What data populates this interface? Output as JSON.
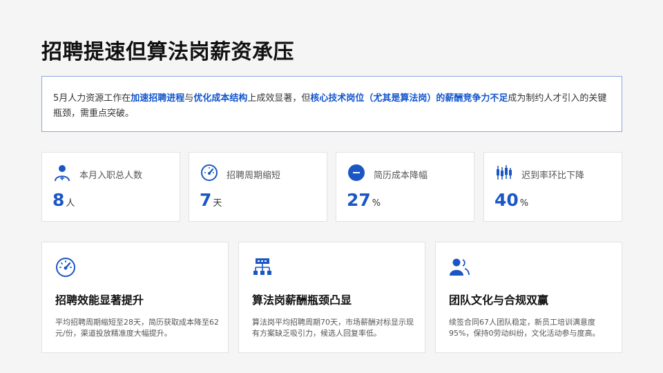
{
  "title": "招聘提速但算法岗薪资承压",
  "summary": {
    "t1": "5月人力资源工作在",
    "h1": "加速招聘进程",
    "t2": "与",
    "h2": "优化成本结构",
    "t3": "上成效显著，但",
    "h3": "核心技术岗位（尤其是算法岗）的薪酬竞争力不足",
    "t4": "成为制约人才引入的关键瓶颈，需重点突破。"
  },
  "stats": [
    {
      "label": "本月入职总人数",
      "value": "8",
      "unit": "人",
      "icon": "user-add-icon"
    },
    {
      "label": "招聘周期缩短",
      "value": "7",
      "unit": "天",
      "icon": "speedometer-icon"
    },
    {
      "label": "简历成本降幅",
      "value": "27",
      "unit": "%",
      "icon": "minus-circle-icon"
    },
    {
      "label": "迟到率环比下降",
      "value": "40",
      "unit": "%",
      "icon": "candlestick-icon"
    }
  ],
  "cards": [
    {
      "title": "招聘效能显著提升",
      "desc": "平均招聘周期缩短至28天，简历获取成本降至62元/份，渠道投放精准度大幅提升。",
      "icon": "speedometer-icon"
    },
    {
      "title": "算法岗薪酬瓶颈凸显",
      "desc": "算法岗平均招聘周期70天，市场薪酬对标显示现有方案缺乏吸引力，候选人回复率低。",
      "icon": "org-chart-icon"
    },
    {
      "title": "团队文化与合规双赢",
      "desc": "续签合同67人团队稳定，新员工培训满意度95%，保持0劳动纠纷，文化活动参与度高。",
      "icon": "team-icon"
    }
  ],
  "colors": {
    "accent": "#1a56c4",
    "border": "#8aa6df"
  }
}
